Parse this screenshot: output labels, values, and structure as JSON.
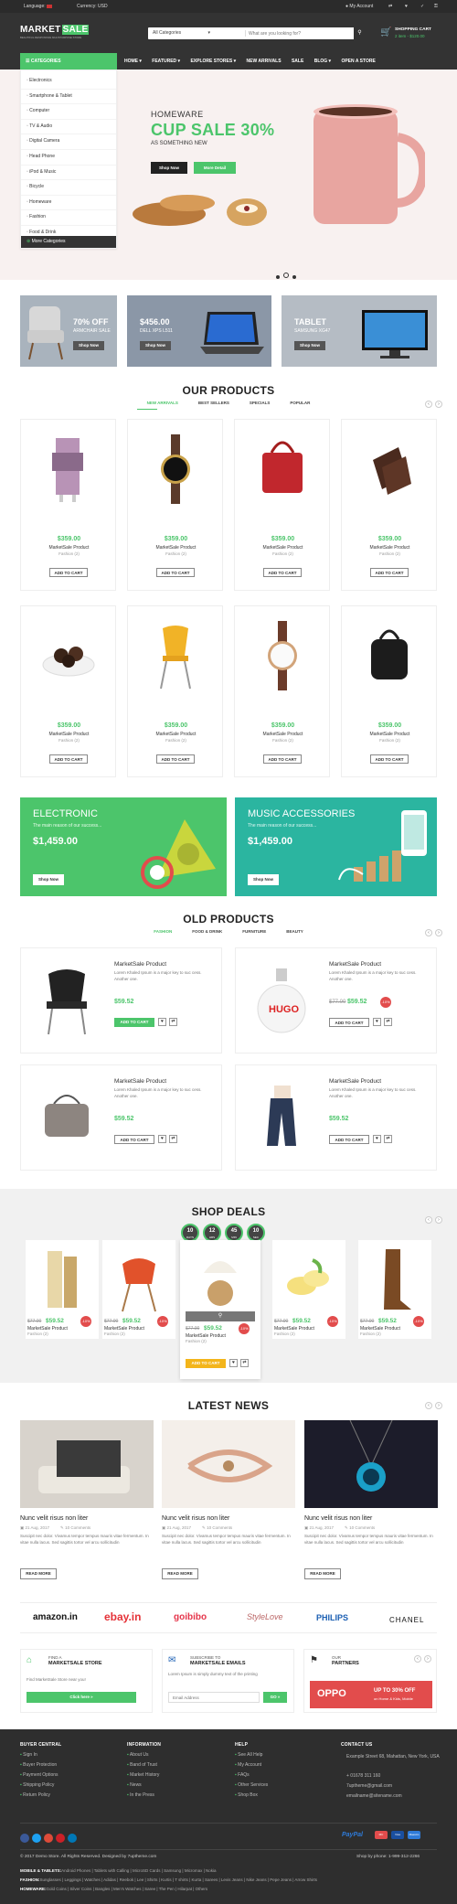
{
  "topbar": {
    "language_label": "Language:",
    "currency_label": "Currency: USD",
    "account": "My Account"
  },
  "header": {
    "logo_a": "MARKET",
    "logo_b": "SALE",
    "tagline": "BEAUTIFUL RESPONSIVE MULTIPURPOSE STORE",
    "category_select": "All Categories",
    "search_placeholder": "What are you looking for?",
    "cart_title": "SHOPPING CART",
    "cart_summary": "2 item - $120.00"
  },
  "nav": {
    "categories": "CATEGORIES",
    "items": [
      "HOME",
      "FEATURED",
      "EXPLORE STORES",
      "NEW ARRIVALS",
      "SALE",
      "BLOG",
      "OPEN A STORE"
    ]
  },
  "sidebar": {
    "items": [
      "Electronics",
      "Smartphone & Tablet",
      "Computer",
      "TV & Audio",
      "Digital Camera",
      "Head Phone",
      "iPod & Music",
      "Bicycle",
      "Homeware",
      "Fashion",
      "Food & Drink"
    ],
    "more": "More Categories"
  },
  "hero": {
    "kicker": "HOMEWARE",
    "headline": "CUP SALE 30%",
    "sub": "AS SOMETHING NEW",
    "btn_shop": "Shop Now",
    "btn_more": "More Detail"
  },
  "promos": [
    {
      "title": "70% OFF",
      "sub": "ARMCHAIR SALE",
      "btn": "Shop Now"
    },
    {
      "title": "$456.00",
      "sub": "DELL XPS L511",
      "btn": "Shop Now"
    },
    {
      "title": "TABLET",
      "sub": "SAMSUNG XG47",
      "btn": "Shop Now"
    }
  ],
  "our_products": {
    "title": "OUR PRODUCTS",
    "tabs": [
      "NEW ARRIVALS",
      "BEST SELLERS",
      "SPECIALS",
      "POPULAR"
    ],
    "products": [
      {
        "price": "$359.00",
        "name": "MarketSale Product",
        "cat": "Fashion (2)",
        "btn": "ADD TO CART"
      },
      {
        "price": "$359.00",
        "name": "MarketSale Product",
        "cat": "Fashion (2)",
        "btn": "ADD TO CART"
      },
      {
        "price": "$359.00",
        "name": "MarketSale Product",
        "cat": "Fashion (2)",
        "btn": "ADD TO CART"
      },
      {
        "price": "$359.00",
        "name": "MarketSale Product",
        "cat": "Fashion (2)",
        "btn": "ADD TO CART"
      },
      {
        "price": "$359.00",
        "name": "MarketSale Product",
        "cat": "Fashion (2)",
        "btn": "ADD TO CART"
      },
      {
        "price": "$359.00",
        "name": "MarketSale Product",
        "cat": "Fashion (2)",
        "btn": "ADD TO CART"
      },
      {
        "price": "$359.00",
        "name": "MarketSale Product",
        "cat": "Fashion (2)",
        "btn": "ADD TO CART"
      },
      {
        "price": "$359.00",
        "name": "MarketSale Product",
        "cat": "Fashion (2)",
        "btn": "ADD TO CART"
      }
    ]
  },
  "banners": [
    {
      "title": "ELECTRONIC",
      "sub": "The main reason of our success...",
      "price": "$1,459.00",
      "btn": "Shop Now"
    },
    {
      "title": "MUSIC ACCESSORIES",
      "sub": "The main reason of our success...",
      "price": "$1,459.00",
      "btn": "Shop Now"
    }
  ],
  "old_products": {
    "title": "OLD PRODUCTS",
    "tabs": [
      "FASHION",
      "FOOD & DRINK",
      "FURNITURE",
      "BEAUTY"
    ],
    "items": [
      {
        "name": "MarketSale Product",
        "desc": "Lorem Khaled Ipsum is a major key to suc cess. Another one.",
        "old": "",
        "price": "$59.52",
        "btn": "ADD TO CART"
      },
      {
        "name": "MarketSale Product",
        "desc": "Lorem Khaled Ipsum is a major key to suc cess. Another one.",
        "old": "$77.00",
        "price": "$59.52",
        "btn": "ADD TO CART"
      },
      {
        "name": "MarketSale Product",
        "desc": "Lorem Khaled Ipsum is a major key to suc cess. Another one.",
        "old": "",
        "price": "$59.52",
        "btn": "ADD TO CART"
      },
      {
        "name": "MarketSale Product",
        "desc": "Lorem Khaled Ipsum is a major key to suc cess. Another one.",
        "old": "",
        "price": "$59.52",
        "btn": "ADD TO CART"
      }
    ]
  },
  "deals": {
    "title": "SHOP DEALS",
    "timer": [
      {
        "v": "10",
        "u": "DAYS"
      },
      {
        "v": "12",
        "u": "HRS"
      },
      {
        "v": "45",
        "u": "MIN"
      },
      {
        "v": "10",
        "u": "SEC"
      }
    ],
    "items": [
      {
        "old": "$77.00",
        "price": "$59.52",
        "name": "MarketSale Product",
        "cat": "Fashion (2)"
      },
      {
        "old": "$77.00",
        "price": "$59.52",
        "name": "MarketSale Product",
        "cat": "Fashion (2)"
      },
      {
        "old": "$77.00",
        "price": "$59.52",
        "name": "MarketSale Product",
        "cat": "Fashion (2)"
      },
      {
        "old": "$77.00",
        "price": "$59.52",
        "name": "MarketSale Product",
        "cat": "Fashion (2)"
      },
      {
        "old": "$77.00",
        "price": "$59.52",
        "name": "MarketSale Product",
        "cat": "Fashion (2)"
      }
    ],
    "badge": "-10%",
    "add": "ADD TO CART"
  },
  "news": {
    "title": "LATEST NEWS",
    "posts": [
      {
        "title": "Nunc velit risus non liter",
        "date": "21 Aug, 2017",
        "comments": "10 Comments",
        "excerpt": "Suscipit nec dolor. Vivamus tempor tempus mauris vitae fermentum. In vitae nulla lacus. Sed sagittis tortor vel arcu sollicitudin",
        "btn": "READ MORE"
      },
      {
        "title": "Nunc velit risus non liter",
        "date": "21 Aug, 2017",
        "comments": "10 Comments",
        "excerpt": "Suscipit nec dolor. Vivamus tempor tempus mauris vitae fermentum. In vitae nulla lacus. Sed sagittis tortor vel arcu sollicitudin",
        "btn": "READ MORE"
      },
      {
        "title": "Nunc velit risus non liter",
        "date": "21 Aug, 2017",
        "comments": "10 Comments",
        "excerpt": "Suscipit nec dolor. Vivamus tempor tempus mauris vitae fermentum. In vitae nulla lacus. Sed sagittis tortor vel arcu sollicitudin",
        "btn": "READ MORE"
      }
    ]
  },
  "brands": [
    "amazon.in",
    "ebay.in",
    "goibibo",
    "StyleLove",
    "PHILIPS",
    "CHANEL"
  ],
  "info": {
    "store_small": "FIND A",
    "store_big": "MARKETSALE STORE",
    "store_text": "Find MarketSale Store near you!",
    "store_btn": "Click here »",
    "sub_small": "SUBSCRIBE TO",
    "sub_big": "MARKETSALE EMAILS",
    "sub_text": "Lorem Ipsum is simply dummy text of the printing",
    "sub_placeholder": "Email Address",
    "sub_btn": "GO »",
    "partners_small": "OUR",
    "partners_big": "PARTNERS",
    "oppo_name": "OPPO",
    "oppo_offer": "UP TO 30% OFF",
    "oppo_sub": "on Home & Kids, Mobile"
  },
  "footer": {
    "cols": [
      {
        "head": "BUYER CENTRAL",
        "items": [
          "Sign In",
          "Buyer Protection",
          "Payment Options",
          "Shipping Policy",
          "Return Policy"
        ]
      },
      {
        "head": "INFORMATION",
        "items": [
          "About Us",
          "Band of Trust",
          "Market History",
          "News",
          "In the Press"
        ]
      },
      {
        "head": "HELP",
        "items": [
          "See All Help",
          "My Account",
          "FAQs",
          "Other Services",
          "Shop Box"
        ]
      }
    ],
    "contact_head": "CONTACT US",
    "contact": [
      "Example Street 68, Mahattan, New York, USA",
      "+ 01678 311 160",
      "7uptheme@gmail.com",
      "emailname@sitename.com"
    ],
    "payments": [
      "PayPal",
      "MC",
      "Visa",
      "Maestro"
    ],
    "copyright": "© 2017 Demo Store. All Rights Reserved. Designed by 7uptheme.com",
    "phone": "Shop by phone: 1-999-312-2266",
    "links": [
      {
        "label": "MOBILE & TABLETS:",
        "text": "Android Phones | Tablets with Calling | MicroSD Cards | Samsung | Micromax | Nokia"
      },
      {
        "label": "FASHION:",
        "text": "Sunglasses | Leggings | Watches | Adidas | Reebok | Lee | Shirts | Kurtis | T shirts | Kurta | Sarees | Levis Jeans | Nike Jeans | Pepe Jeans | Arrow Shirts"
      },
      {
        "label": "HOMEWARE:",
        "text": "Gold Coins | Silver Coins | Bangles | Men's Watches | Saree | The Pen | Hilarpat | Others"
      }
    ]
  },
  "colors": {
    "accent": "#4cc56b",
    "dark": "#333333",
    "red": "#e24c4c",
    "teal": "#2bb5a0"
  }
}
